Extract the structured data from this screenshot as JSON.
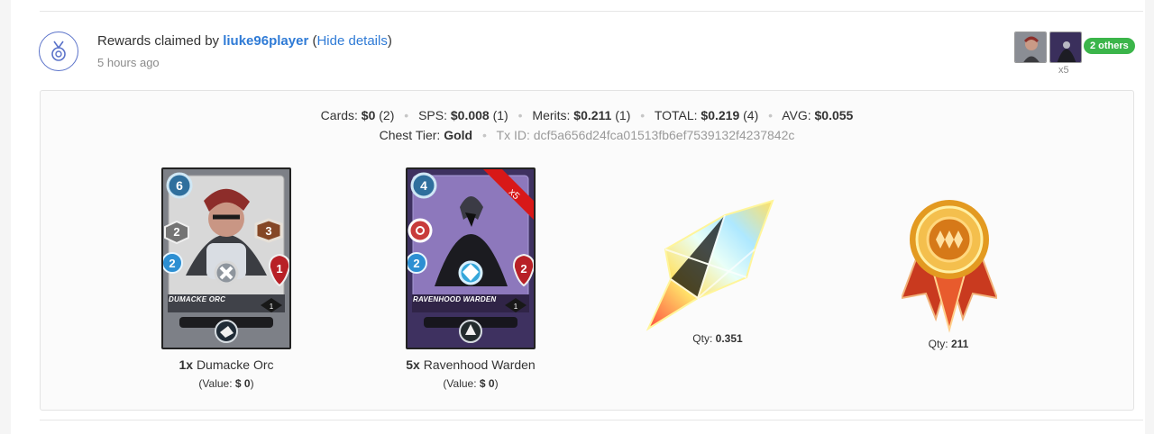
{
  "header": {
    "prefix": "Rewards claimed by ",
    "username": "liuke96player",
    "open_paren": " (",
    "toggle_label": "Hide details",
    "close_paren": ")",
    "timestamp": "5 hours ago"
  },
  "participants": {
    "others_label": "2 others",
    "multiplier": "x5"
  },
  "summary": {
    "cards_label": "Cards:",
    "cards_value": "$0",
    "cards_count": "(2)",
    "sps_label": "SPS:",
    "sps_value": "$0.008",
    "sps_count": "(1)",
    "merits_label": "Merits:",
    "merits_value": "$0.211",
    "merits_count": "(1)",
    "total_label": "TOTAL:",
    "total_value": "$0.219",
    "total_count": "(4)",
    "avg_label": "AVG:",
    "avg_value": "$0.055",
    "chest_label": "Chest Tier:",
    "chest_value": "Gold",
    "tx_label": "Tx ID:",
    "tx_value": "dcf5a656d24fca01513fb6ef7539132f4237842c"
  },
  "rewards": [
    {
      "count": "1x",
      "name": "Dumacke Orc",
      "card_title": "DUMACKE ORC",
      "mana": "6",
      "attack": "3",
      "speed": "2",
      "armor": "2",
      "health": "1",
      "level": "1",
      "value_prefix": "(Value:",
      "value": "$ 0",
      "value_suffix": ")"
    },
    {
      "count": "5x",
      "name": "Ravenhood Warden",
      "card_title": "RAVENHOOD WARDEN",
      "ribbon": "x5",
      "mana": "4",
      "speed": "2",
      "health": "2",
      "level": "1",
      "value_prefix": "(Value:",
      "value": "$ 0",
      "value_suffix": ")"
    },
    {
      "qty_label": "Qty:",
      "qty": "0.351"
    },
    {
      "qty_label": "Qty:",
      "qty": "211"
    }
  ]
}
